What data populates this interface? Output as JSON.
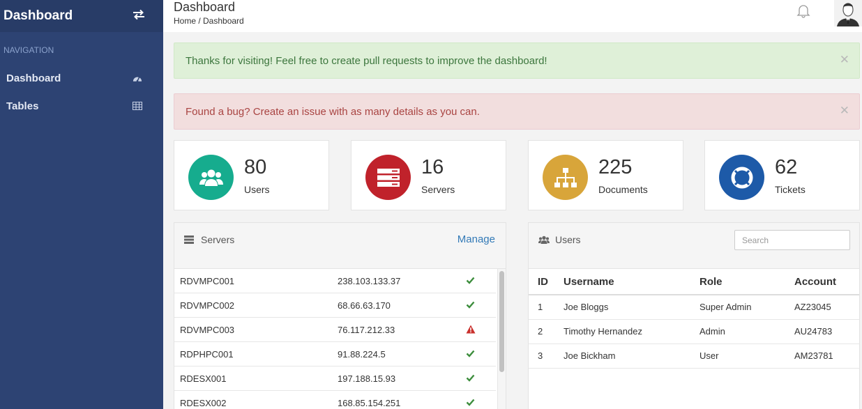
{
  "sidebar": {
    "brand": "Dashboard",
    "nav_heading": "NAVIGATION",
    "items": [
      {
        "label": "Dashboard",
        "icon": "dashboard-gauge-icon"
      },
      {
        "label": "Tables",
        "icon": "table-icon"
      }
    ]
  },
  "header": {
    "title": "Dashboard",
    "breadcrumb": "Home / Dashboard"
  },
  "alerts": [
    {
      "text": "Thanks for visiting! Feel free to create pull requests to improve the dashboard!",
      "type": "success"
    },
    {
      "text": "Found a bug? Create an issue with as many details as you can.",
      "type": "danger"
    }
  ],
  "stats": [
    {
      "value": "80",
      "label": "Users",
      "color": "#16ac8e",
      "icon": "users-icon"
    },
    {
      "value": "16",
      "label": "Servers",
      "color": "#c0222b",
      "icon": "server-icon"
    },
    {
      "value": "225",
      "label": "Documents",
      "color": "#d8a53a",
      "icon": "sitemap-icon"
    },
    {
      "value": "62",
      "label": "Tickets",
      "color": "#1d5aa8",
      "icon": "lifebuoy-icon"
    }
  ],
  "servers_panel": {
    "title": "Servers",
    "manage_label": "Manage",
    "rows": [
      {
        "name": "RDVMPC001",
        "ip": "238.103.133.37",
        "status": "ok"
      },
      {
        "name": "RDVMPC002",
        "ip": "68.66.63.170",
        "status": "ok"
      },
      {
        "name": "RDVMPC003",
        "ip": "76.117.212.33",
        "status": "warning"
      },
      {
        "name": "RDPHPC001",
        "ip": "91.88.224.5",
        "status": "ok"
      },
      {
        "name": "RDESX001",
        "ip": "197.188.15.93",
        "status": "ok"
      },
      {
        "name": "RDESX002",
        "ip": "168.85.154.251",
        "status": "ok"
      }
    ]
  },
  "users_panel": {
    "title": "Users",
    "search_placeholder": "Search",
    "columns": [
      "ID",
      "Username",
      "Role",
      "Account"
    ],
    "rows": [
      {
        "id": "1",
        "username": "Joe Bloggs",
        "role": "Super Admin",
        "account": "AZ23045"
      },
      {
        "id": "2",
        "username": "Timothy Hernandez",
        "role": "Admin",
        "account": "AU24783"
      },
      {
        "id": "3",
        "username": "Joe Bickham",
        "role": "User",
        "account": "AM23781"
      }
    ]
  },
  "colors": {
    "sidebar": "#2d4373",
    "ok": "#3c8d3c",
    "warning": "#c9302c",
    "link": "#337ab7"
  }
}
